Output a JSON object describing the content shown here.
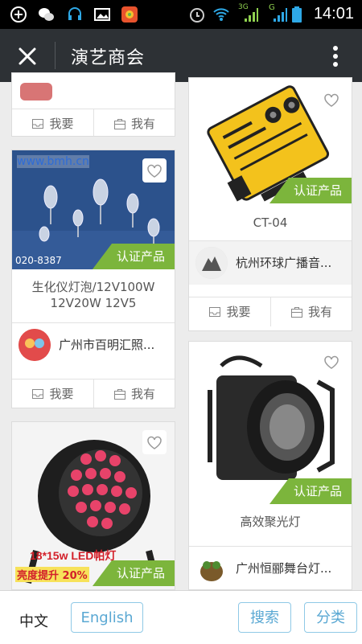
{
  "status_bar": {
    "time": "14:01",
    "network_label": "3G",
    "network_label2": "G"
  },
  "header": {
    "title": "演艺商会"
  },
  "common": {
    "want_label": "我要",
    "have_label": "我有",
    "certified_label": "认证产品"
  },
  "products": [
    {
      "name_line1": "生化仪灯泡/12V100W",
      "name_line2": "12V20W 12V5",
      "seller": "广州市百明汇照...",
      "image_watermark": "www.bmh.cn",
      "image_phone": "020-8387"
    },
    {
      "name": "CT-04",
      "seller": "杭州环球广播音..."
    },
    {
      "name": "",
      "seller": "",
      "image_caption_line1": "18*15w LED帕灯",
      "image_caption_line2": "亮度提升 20%"
    },
    {
      "name": "高效聚光灯",
      "seller": "广州恒郦舞台灯..."
    }
  ],
  "footer": {
    "lang_cn": "中文",
    "lang_en": "English",
    "search_label": "搜索",
    "category_label": "分类"
  },
  "colors": {
    "header_bg": "#2d3135",
    "badge_green": "#7cb53c",
    "pill_blue": "#5aa8d3"
  }
}
